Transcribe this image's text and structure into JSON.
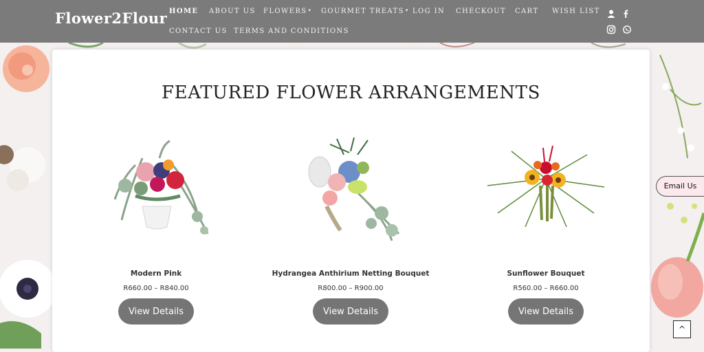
{
  "brand": {
    "name": "Flower2Flour"
  },
  "nav": {
    "items": [
      {
        "label": "HOME",
        "active": true
      },
      {
        "label": "ABOUT US"
      },
      {
        "label": "FLOWERS",
        "dropdown": true
      },
      {
        "label": "GOURMET TREATS",
        "dropdown": true
      },
      {
        "label": "LOG IN"
      },
      {
        "label": "CHECKOUT"
      },
      {
        "label": "CART"
      },
      {
        "label": "WISH LIST"
      },
      {
        "label": "CONTACT US"
      },
      {
        "label": "TERMS AND CONDITIONS"
      }
    ],
    "caret": "▾",
    "social_icons": [
      "user-icon",
      "facebook-icon",
      "instagram-icon",
      "whatsapp-icon"
    ]
  },
  "main": {
    "title": "FEATURED FLOWER ARRANGEMENTS",
    "products": [
      {
        "name": "Modern Pink",
        "price": "R660.00 – R840.00",
        "button": "View Details"
      },
      {
        "name": "Hydrangea Anthirium Netting Bouquet",
        "price": "R800.00 – R900.00",
        "button": "View Details"
      },
      {
        "name": "Sunflower Bouquet",
        "price": "R560.00 – R660.00",
        "button": "View Details"
      }
    ]
  },
  "widgets": {
    "email_tab": "Email Us",
    "scroll_top_icon": "chevron-up-icon",
    "scroll_top_glyph": "^"
  },
  "colors": {
    "header_bg": "#7b7b7b",
    "button_bg": "#757575",
    "email_tab_bg": "#fbe9ee"
  }
}
